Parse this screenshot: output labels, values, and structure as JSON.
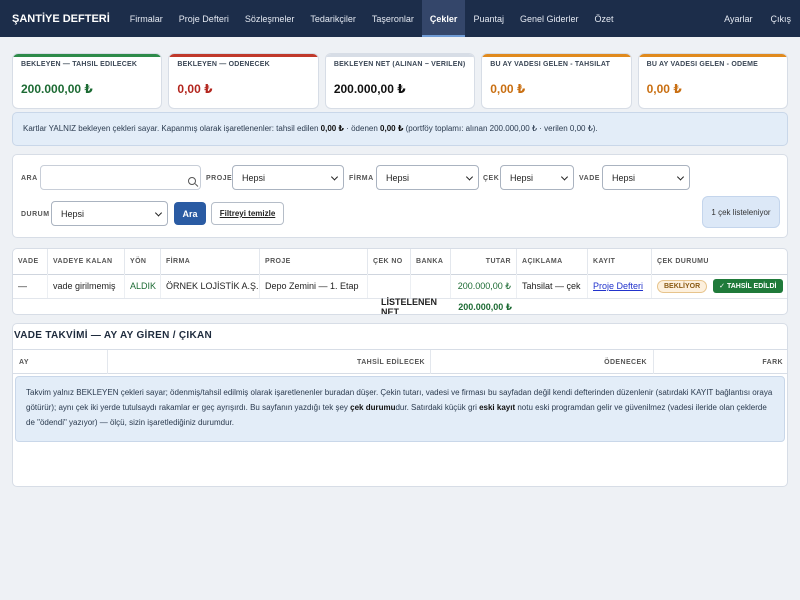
{
  "app": {
    "title": "ŞANTİYE DEFTERİ"
  },
  "nav": {
    "items": [
      "Firmalar",
      "Proje Defteri",
      "Sözleşmeler",
      "Tedarikçiler",
      "Taşeronlar",
      "Çekler",
      "Puantaj",
      "Genel Giderler",
      "Özet"
    ],
    "active": "Çekler",
    "right": [
      "Ayarlar",
      "Çıkış"
    ]
  },
  "cards": [
    {
      "label": "BEKLEYEN — TAHSİL EDİLECEK",
      "value": "200.000,00 ₺",
      "accent": "#2e8b4a",
      "color": "#1d6b34"
    },
    {
      "label": "BEKLEYEN — ÖDENECEK",
      "value": "0,00 ₺",
      "accent": "#c0392b",
      "color": "#b3261e"
    },
    {
      "label": "BEKLEYEN NET (ALINAN − VERİLEN)",
      "value": "200.000,00 ₺",
      "accent": "#d7dde6",
      "color": "#111111"
    },
    {
      "label": "BU AY VADESİ GELEN - TAHSİLAT",
      "value": "0,00 ₺",
      "accent": "#e08a1e",
      "color": "#c96f12"
    },
    {
      "label": "BU AY VADESİ GELEN - ÖDEME",
      "value": "0,00 ₺",
      "accent": "#e08a1e",
      "color": "#c96f12"
    }
  ],
  "info": {
    "p1": "Kartlar YALNIZ bekleyen çekleri sayar. Kapanmış olarak işaretlenenler: tahsil edilen ",
    "v1": "0,00 ₺",
    "p2": " · ödenen ",
    "v2": "0,00 ₺",
    "p3": " (portföy toplamı: alınan 200.000,00 ₺ · verilen 0,00 ₺)."
  },
  "filters": {
    "ara_label": "ARA",
    "search_value": "",
    "proje_label": "PROJE",
    "proje_value": "Hepsi",
    "firma_label": "FİRMA",
    "firma_value": "Hepsi",
    "cek_label": "ÇEK",
    "cek_value": "Hepsi",
    "vade_label": "VADE",
    "vade_value": "Hepsi",
    "durum_label": "DURUM",
    "durum_value": "Hepsi",
    "ara_button": "Ara",
    "clear_button": "Filtreyi temizle",
    "count_text": "1 çek listeleniyor"
  },
  "table": {
    "headers": [
      "VADE",
      "VADEYE KALAN",
      "YÖN",
      "FİRMA",
      "PROJE",
      "ÇEK NO",
      "BANKA",
      "TUTAR",
      "AÇIKLAMA",
      "KAYIT",
      "ÇEK DURUMU"
    ],
    "row": {
      "vade": "—",
      "kalan": "vade girilmemiş",
      "yon": "ALDIK",
      "firma": "ÖRNEK LOJİSTİK A.Ş.",
      "proje": "Depo Zemini — 1. Etap",
      "cek_no": "",
      "banka": "",
      "tutar": "200.000,00 ₺",
      "aciklama": "Tahsilat — çek",
      "kayit": "Proje Defteri",
      "durum": "BEKLİYOR",
      "action": "✓ TAHSİL EDİLDİ"
    },
    "footer_label": "LİSTELENEN NET",
    "footer_value": "200.000,00 ₺"
  },
  "vade": {
    "title": "VADE TAKVİMİ — AY AY GİREN / ÇIKAN",
    "headers": [
      "AY",
      "TAHSİL EDİLECEK",
      "ÖDENECEK",
      "FARK"
    ],
    "note": {
      "p1": "Takvim yalnız BEKLEYEN çekleri sayar; ödenmiş/tahsil edilmiş olarak işaretlenenler buradan düşer. Çekin tutarı, vadesi ve firması bu sayfadan değil kendi defterinden düzenlenir (satırdaki KAYIT bağlantısı oraya götürür); aynı çek iki yerde tutulsaydı rakamlar er geç ayrışırdı. Bu sayfanın yazdığı tek şey ",
      "b1": "çek durumu",
      "p2": "dur. Satırdaki küçük gri ",
      "b2": "eski kayıt",
      "p3": " notu eski programdan gelir ve güvenilmez (vadesi ileride olan çeklerde de \"ödendi\" yazıyor) — ölçü, sizin işaretlediğiniz durumdur."
    }
  },
  "colors": {
    "nav_bg": "#1c2d4a",
    "primary": "#2a5ba3",
    "success": "#1f7a3a",
    "in_green": "#1d6b34"
  }
}
